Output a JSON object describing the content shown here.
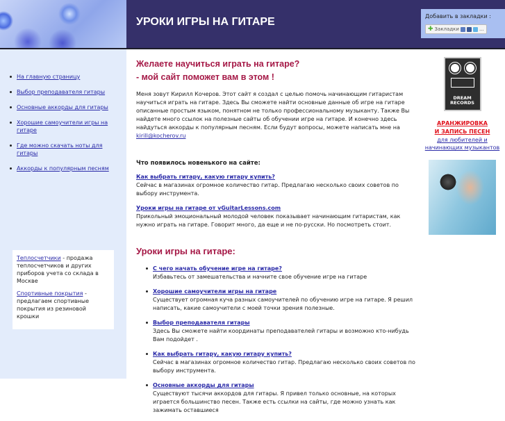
{
  "header": {
    "title": "УРОКИ ИГРЫ НА ГИТАРЕ"
  },
  "bookmarks": {
    "label": "Добавить в закладки :",
    "button": "Закладки",
    "more": "..."
  },
  "sidebar": {
    "nav": [
      {
        "label": "На главную страницу"
      },
      {
        "label": "Выбор преподавателя гитары"
      },
      {
        "label": "Основные аккорды для гитары"
      },
      {
        "label": "Хорошие самоучители игры на гитаре"
      },
      {
        "label": "Где можно скачать ноты для гитары"
      },
      {
        "label": "Аккорды к популярным песням"
      }
    ],
    "ads": [
      {
        "link": "Теплосчетчики",
        "text": " - продажа теплосчетчиков и других приборов учета со склада в Москве"
      },
      {
        "link": "Спортивные покрытия",
        "text": " - предлагаем спортивные покрытия из резиновой крошки"
      }
    ]
  },
  "main": {
    "headline1": "Желаете научиться играть на гитаре?",
    "headline2": "- мой сайт поможет вам в этом !",
    "intro": "Меня зовут Кирилл Кочеров. Этот сайт я создал с целью помочь начинающим гитаристам научиться играть на гитаре. Здесь Вы сможете найти основные данные об игре на гитаре описанные простым языком, понятном не только профессиональному музыканту. Также Вы найдете много ссылок на полезные сайты об обучении игре на гитаре. И конечно здесь найдуться аккорды к популярным песням. Если будут вопросы, можете написать мне на ",
    "email": "kirill@kocherov.ru",
    "news_title": "Что появилось новенького на сайте:",
    "news": [
      {
        "link": "Как выбрать гитару, какую гитару купить?",
        "text": "Сейчас в магазинах огромное количество гитар. Предлагаю несколько своих советов по выбору инструмента."
      },
      {
        "link": "Уроки игры на гитаре от vGuitarLessons.com",
        "text": "Прикольный эмоциональный молодой человек показывает начинающим гитаристам, как нужно играть на гитаре. Говорит много, да еще и не по-русски. Но посмотреть стоит."
      }
    ],
    "lessons_title": "Уроки игры на гитаре:",
    "lessons": [
      {
        "link": "С чего начать обучение игре на гитаре?",
        "text": "Избавьтесь от замешательства и начните свое обучение игре на гитаре"
      },
      {
        "link": "Хорошие самоучители игры на гитаре",
        "text": "Существует огромная куча разных самоучителей по обучению игре на гитаре. Я решил написать, какие самоучители с моей точки зрения полезные."
      },
      {
        "link": "Выбор преподавателя гитары",
        "text": "Здесь Вы сможете найти координаты преподавателей гитары и возможно кто-нибудь Вам подойдет ."
      },
      {
        "link": "Как выбрать гитару, какую гитару купить?",
        "text": "Сейчас в магазинах огромное количество гитар. Предлагаю несколько своих советов по выбору инструмента."
      },
      {
        "link": "Основные аккорды для гитары",
        "text": "Существуют тысячи аккордов для гитары. Я привел только основные, на которых играется большинство песен. Также есть ссылки на сайты, где можно узнать как зажимать оставшиеся"
      }
    ]
  },
  "right": {
    "logo_text": "DREAM RECORDS",
    "promo1": "АРАНЖИРОВКА",
    "promo2": "И ЗАПИСЬ ПЕСЕН",
    "promo_sub": "для любителей и начинающих музыкантов"
  }
}
